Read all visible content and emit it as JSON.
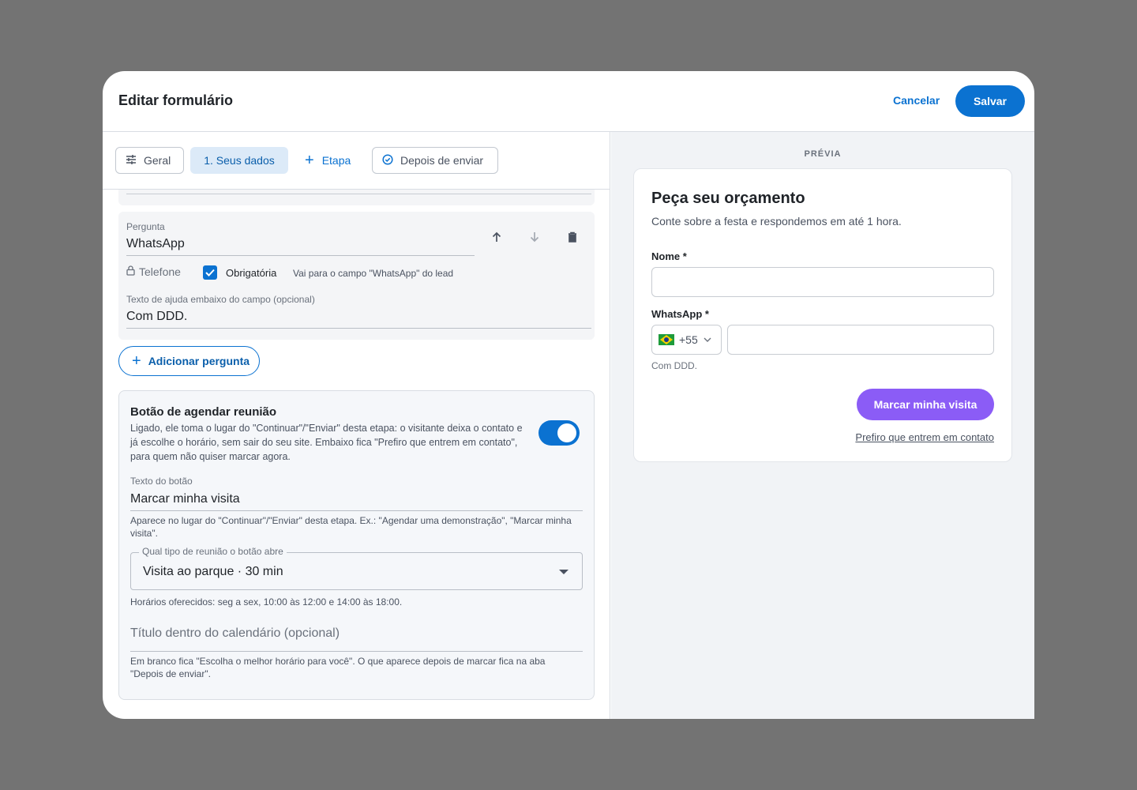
{
  "modal": {
    "title": "Editar formulário",
    "cancel_label": "Cancelar",
    "save_label": "Salvar"
  },
  "tabs": [
    {
      "label": "Geral",
      "icon": "sliders-icon"
    },
    {
      "label": "1. Seus dados",
      "active": true
    },
    {
      "label": "Etapa",
      "icon": "plus-icon"
    },
    {
      "label": "Depois de enviar",
      "icon": "check-circle-icon"
    }
  ],
  "question": {
    "label": "Pergunta",
    "value": "WhatsApp",
    "type": "Telefone",
    "required_label": "Obrigatória",
    "required": true,
    "mapping_hint": "Vai para o campo \"WhatsApp\" do lead",
    "help_label": "Texto de ajuda embaixo do campo (opcional)",
    "help_value": "Com DDD."
  },
  "add_question_label": "Adicionar pergunta",
  "meeting": {
    "title": "Botão de agendar reunião",
    "description": "Ligado, ele toma o lugar do \"Continuar\"/\"Enviar\" desta etapa: o visitante deixa o contato e já escolhe o horário, sem sair do seu site. Embaixo fica \"Prefiro que entrem em contato\", para quem não quiser marcar agora.",
    "enabled": true,
    "button_text_label": "Texto do botão",
    "button_text_value": "Marcar minha visita",
    "button_text_help": "Aparece no lugar do \"Continuar\"/\"Enviar\" desta etapa. Ex.: \"Agendar uma demonstração\", \"Marcar minha visita\".",
    "type_label": "Qual tipo de reunião o botão abre",
    "type_value": "Visita ao parque · 30 min",
    "schedule_help": "Horários oferecidos: seg a sex, 10:00 às 12:00 e 14:00 às 18:00.",
    "calendar_title_placeholder": "Título dentro do calendário (opcional)",
    "calendar_title_help": "Em branco fica \"Escolha o melhor horário para você\". O que aparece depois de marcar fica na aba \"Depois de enviar\"."
  },
  "preview": {
    "section_label": "PRÉVIA",
    "title": "Peça seu orçamento",
    "subtitle": "Conte sobre a festa e respondemos em até 1 hora.",
    "name_label": "Nome *",
    "whatsapp_label": "WhatsApp *",
    "country_code": "+55",
    "whatsapp_help": "Com DDD.",
    "button_label": "Marcar minha visita",
    "link_label": "Prefiro que entrem em contato"
  },
  "colors": {
    "primary": "#0b72d1",
    "preview_button": "#8b5cf6",
    "backdrop": "#737373"
  }
}
